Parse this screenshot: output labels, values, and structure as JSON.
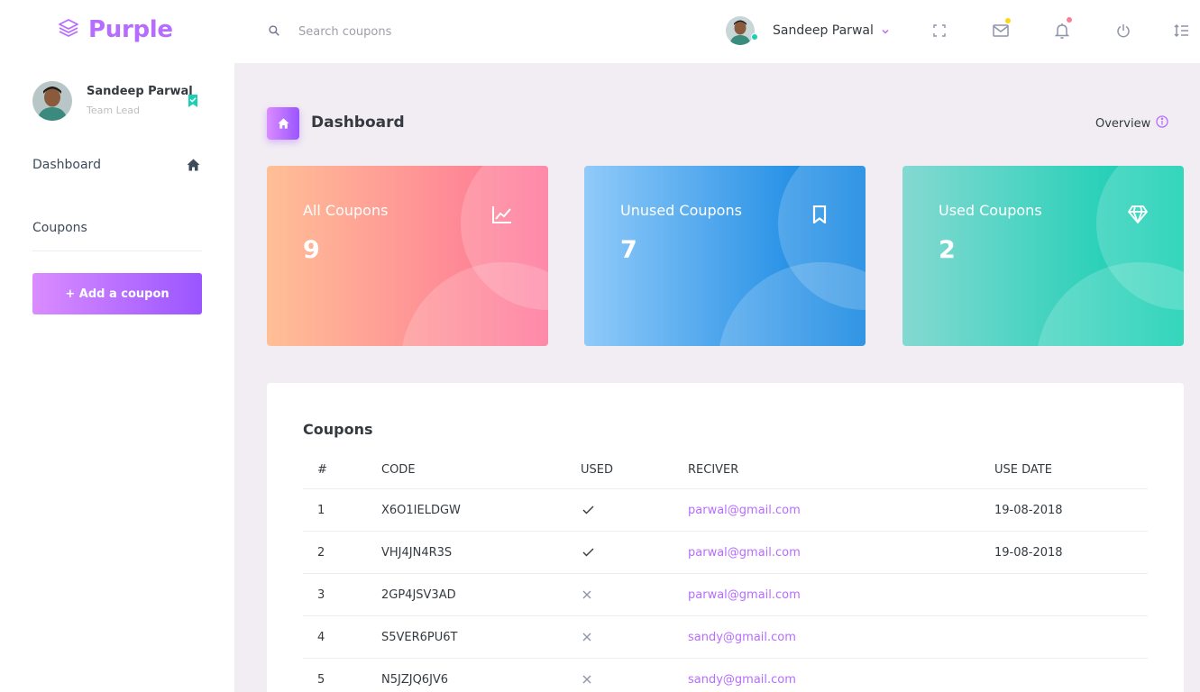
{
  "brand": {
    "name": "Purple"
  },
  "search": {
    "placeholder": "Search coupons"
  },
  "header": {
    "user_name": "Sandeep Parwal"
  },
  "sidebar": {
    "profile": {
      "name": "Sandeep Parwal",
      "role": "Team Lead"
    },
    "items": [
      {
        "label": "Dashboard",
        "icon": "home-icon"
      },
      {
        "label": "Coupons"
      }
    ],
    "add_button": "+ Add a coupon"
  },
  "page": {
    "title": "Dashboard",
    "overview": "Overview"
  },
  "stats": [
    {
      "label": "All Coupons",
      "value": "9",
      "icon": "chart-line-icon"
    },
    {
      "label": "Unused Coupons",
      "value": "7",
      "icon": "bookmark-icon"
    },
    {
      "label": "Used Coupons",
      "value": "2",
      "icon": "diamond-icon"
    }
  ],
  "table": {
    "title": "Coupons",
    "columns": [
      "#",
      "CODE",
      "USED",
      "RECIVER",
      "USE DATE"
    ],
    "rows": [
      {
        "num": "1",
        "code": "X6O1IELDGW",
        "used": true,
        "receiver": "parwal@gmail.com",
        "date": "19-08-2018"
      },
      {
        "num": "2",
        "code": "VHJ4JN4R3S",
        "used": true,
        "receiver": "parwal@gmail.com",
        "date": "19-08-2018"
      },
      {
        "num": "3",
        "code": "2GP4JSV3AD",
        "used": false,
        "receiver": "parwal@gmail.com",
        "date": ""
      },
      {
        "num": "4",
        "code": "S5VER6PU6T",
        "used": false,
        "receiver": "sandy@gmail.com",
        "date": ""
      },
      {
        "num": "5",
        "code": "N5JZJQ6JV6",
        "used": false,
        "receiver": "sandy@gmail.com",
        "date": ""
      }
    ]
  },
  "colors": {
    "accent": "#b66dff",
    "online": "#1bcfb4",
    "mail_badge": "#fed713",
    "bell_badge": "#fe7c96"
  }
}
